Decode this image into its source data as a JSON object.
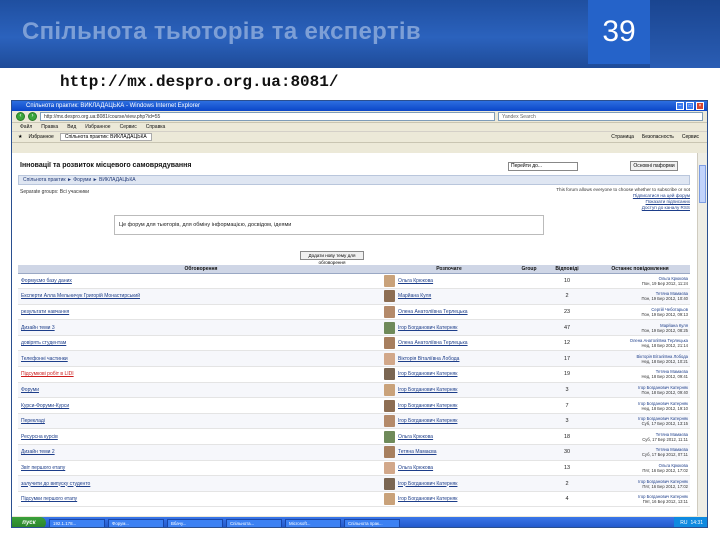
{
  "slide": {
    "title": "Спільнота тьюторів та експертів",
    "number": "39",
    "url": "http://mx.despro.org.ua:8081/"
  },
  "browser": {
    "window_title": "Спільнота практик: ВИКЛАДАЦЬКА - Windows Internet Explorer",
    "address": "http://mx.despro.org.ua:8081/course/view.php?id=55",
    "search_placeholder": "Yandex Search",
    "menu": [
      "Файл",
      "Правка",
      "Вид",
      "Избранное",
      "Сервис",
      "Справка"
    ],
    "favorites_label": "Избранное",
    "tab_label": "Спільнота практик: ВИКЛАДАЦЬКА",
    "right_tools": [
      "Страница",
      "Безопасность",
      "Сервис"
    ]
  },
  "page": {
    "course_title": "Інновації та розвиток місцевого самоврядування",
    "jump_placeholder": "Перейти до...",
    "edit_button": "Основні паформи",
    "breadcrumb": "Спільнота практик ► Форуми ► ВИКЛАДАЦЬКА",
    "group_mode": "Separate groups: Всі учасники",
    "info_text": "This forum allows everyone to choose whether to subscribe or not",
    "info_links": [
      "Підписатися на цей форум",
      "Показати підписаних",
      "Доступ до каналу RSS"
    ],
    "intro": "Це форум для тьюторів, для обміну інформацією, досвідом, ідеями",
    "add_button": "Додати нову тему для обговорення"
  },
  "table": {
    "headers": [
      "Обговорення",
      "Розпочате",
      "Group",
      "Відповіді",
      "Останнє повідомлення"
    ],
    "rows": [
      {
        "topic": "Формуємо базу даних",
        "author": "Ольга Крюкова",
        "replies": "10",
        "last_who": "Ольга Крюкова",
        "last_date": "Пон, 19 Бер 2012, 11:24"
      },
      {
        "topic": "Експерти Алла Мельничук Григорій Монастирський",
        "author": "Марйана Куля",
        "replies": "2",
        "last_who": "Тетяна Мамаєва",
        "last_date": "Пон, 19 Бер 2012, 10:40"
      },
      {
        "topic": "результати навчання",
        "author": "Олена Анатоліївна Терлецька",
        "replies": "23",
        "last_who": "Сергій Чеботарьов",
        "last_date": "Пон, 19 Бер 2012, 09:13"
      },
      {
        "topic": "Дизайн теми 3",
        "author": "Ігор Богданович Катерняк",
        "replies": "47",
        "last_who": "Марйана Куля",
        "last_date": "Пон, 19 Бер 2012, 08:25"
      },
      {
        "topic": "довірять студентам",
        "author": "Олена Анатоліївна Терлецька",
        "replies": "12",
        "last_who": "Олена Анатоліївна Терлецька",
        "last_date": "Нед, 18 Бер 2012, 21:14"
      },
      {
        "topic": "Телефонні частинки",
        "author": "Вікторія Віталіївна Лобода",
        "replies": "17",
        "last_who": "Вікторія Віталіївна Лобода",
        "last_date": "Нед, 18 Бер 2012, 10:21"
      },
      {
        "topic": "Підсумкові робіт в LIDI",
        "author": "Ігор Богданович Катерняк",
        "replies": "19",
        "last_who": "Тетяна Мамаєва",
        "last_date": "Нед, 18 Бер 2012, 09:41",
        "red": true
      },
      {
        "topic": "Форуми",
        "author": "Ігор Богданович Катерняк",
        "replies": "3",
        "last_who": "Ігор Богданович Катерняк",
        "last_date": "Пон, 18 Бер 2012, 09:40"
      },
      {
        "topic": "Курси-Форуми-Курси",
        "author": "Ігор Богданович Катерняк",
        "replies": "7",
        "last_who": "Ігор Богданович Катерняк",
        "last_date": "Нед, 18 Бер 2012, 19:10"
      },
      {
        "topic": "Перекладі",
        "author": "Ігор Богданович Катерняк",
        "replies": "3",
        "last_who": "Ігор Богданович Катерняк",
        "last_date": "Суб, 17 Бер 2012, 13:15"
      },
      {
        "topic": "Ресурсна курсів",
        "author": "Ольга Крюкова",
        "replies": "18",
        "last_who": "Тетяна Мамаєва",
        "last_date": "Суб, 17 Бер 2012, 11:11"
      },
      {
        "topic": "Дизайн теми 2",
        "author": "Тетяна Мамаєва",
        "replies": "30",
        "last_who": "Тетяна Мамаєва",
        "last_date": "Суб, 17 Бер 2012, 07:11"
      },
      {
        "topic": "Звіт першого етапу",
        "author": "Ольга Крюкова",
        "replies": "13",
        "last_who": "Ольга Крюкова",
        "last_date": "Пят, 16 Бер 2012, 17:02"
      },
      {
        "topic": "залучити до випуску студенто",
        "author": "Ігор Богданович Катерняк",
        "replies": "2",
        "last_who": "Ігор Богданович Катерняк",
        "last_date": "Пят, 16 Бер 2012, 17:02"
      },
      {
        "topic": "Підсумки першого етапу",
        "author": "Ігор Богданович Катерняк",
        "replies": "4",
        "last_who": "Ігор Богданович Катерняк",
        "last_date": "Пят, 16 Бер 2012, 13:11"
      }
    ]
  },
  "taskbar": {
    "start": "пуск",
    "items": [
      "192.1.178...",
      "Форум...",
      "Вбачу...",
      "Спільнота...",
      "Microsoft...",
      "Спільнота прак..."
    ],
    "clock": "14:31",
    "lang": "RU"
  },
  "colors": {
    "header_bg": "#2b62bd",
    "title_text": "#7d9fd6",
    "link": "#1d3e8a",
    "table_header": "#cfd6e6",
    "highlight_red": "#cc1a1a"
  }
}
